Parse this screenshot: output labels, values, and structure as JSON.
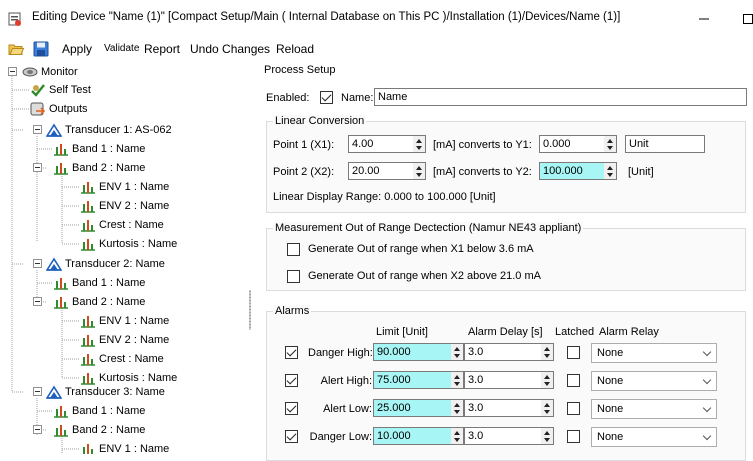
{
  "window": {
    "title": "Editing Device \"Name (1)\" [Compact Setup/Main ( Internal Database on This PC )/Installation (1)/Devices/Name (1)]"
  },
  "toolbar": {
    "apply": "Apply",
    "validate": "Validate",
    "report": "Report",
    "undo": "Undo Changes",
    "reload": "Reload"
  },
  "tree": {
    "monitor": "Monitor",
    "self_test": "Self Test",
    "outputs": "Outputs",
    "t1": "Transducer 1: AS-062",
    "t1_band1": "Band 1 : Name",
    "t1_band2": "Band 2 : Name",
    "t1_env1": "ENV 1 : Name",
    "t1_env2": "ENV 2 : Name",
    "t1_crest": "Crest : Name",
    "t1_kurt": "Kurtosis : Name",
    "t2": "Transducer 2: Name",
    "t2_band1": "Band 1 : Name",
    "t2_band2": "Band 2 : Name",
    "t2_env1": "ENV 1 : Name",
    "t2_env2": "ENV 2 : Name",
    "t2_crest": "Crest : Name",
    "t2_kurt": "Kurtosis : Name",
    "t3": "Transducer 3: Name",
    "t3_band1": "Band 1 : Name",
    "t3_band2": "Band 2 : Name",
    "t3_env1": "ENV 1 : Name"
  },
  "process": {
    "heading": "Process Setup",
    "enabled_label": "Enabled:",
    "name_label": "Name:",
    "name_value": "Name"
  },
  "linear": {
    "title": "Linear Conversion",
    "p1_label": "Point 1 (X1):",
    "p1_x": "4.00",
    "p1_mid": "[mA] converts to Y1:",
    "p1_y": "0.000",
    "unit_value": "Unit",
    "p2_label": "Point 2 (X2):",
    "p2_x": "20.00",
    "p2_mid": "[mA] converts to Y2:",
    "p2_y": "100.000",
    "unit_bracket": "[Unit]",
    "range_text": "Linear Display Range: 0.000 to 100.000 [Unit]"
  },
  "range": {
    "title": "Measurement Out of Range Dectection (Namur NE43 appliant)",
    "below": "Generate Out of range when X1 below 3.6 mA",
    "above": "Generate Out of range when X2 above 21.0 mA"
  },
  "alarms": {
    "title": "Alarms",
    "col_limit": "Limit [Unit]",
    "col_delay": "Alarm Delay [s]",
    "col_latched": "Latched",
    "col_relay": "Alarm Relay",
    "rows": [
      {
        "label": "Danger High:",
        "limit": "90.000",
        "delay": "3.0",
        "relay": "None"
      },
      {
        "label": "Alert High:",
        "limit": "75.000",
        "delay": "3.0",
        "relay": "None"
      },
      {
        "label": "Alert Low:",
        "limit": "25.000",
        "delay": "3.0",
        "relay": "None"
      },
      {
        "label": "Danger Low:",
        "limit": "10.000",
        "delay": "3.0",
        "relay": "None"
      }
    ]
  },
  "colors": {
    "highlight_field": "#a7f5f5",
    "group_border": "#dcdcdc",
    "tree_icon_green": "#2e8b2e",
    "transducer_blue": "#1f5fbf"
  }
}
